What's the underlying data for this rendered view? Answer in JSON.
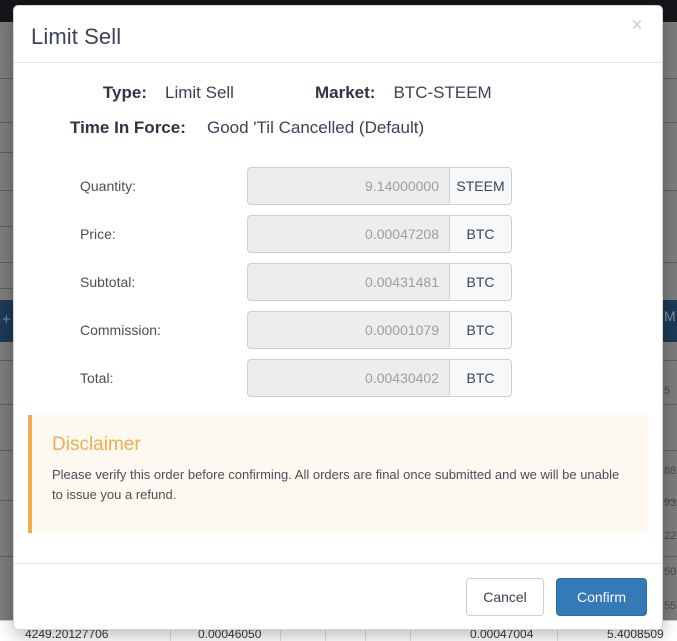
{
  "modal": {
    "title": "Limit Sell",
    "close_label": "×",
    "summary": {
      "type_label": "Type:",
      "type_value": "Limit Sell",
      "market_label": "Market:",
      "market_value": "BTC-STEEM",
      "tif_label": "Time In Force:",
      "tif_value": "Good 'Til Cancelled (Default)"
    },
    "fields": [
      {
        "label": "Quantity:",
        "value": "9.14000000",
        "unit": "STEEM"
      },
      {
        "label": "Price:",
        "value": "0.00047208",
        "unit": "BTC"
      },
      {
        "label": "Subtotal:",
        "value": "0.00431481",
        "unit": "BTC"
      },
      {
        "label": "Commission:",
        "value": "0.00001079",
        "unit": "BTC"
      },
      {
        "label": "Total:",
        "value": "0.00430402",
        "unit": "BTC"
      }
    ],
    "disclaimer": {
      "title": "Disclaimer",
      "text": "Please verify this order before confirming. All orders are final once submitted and we will be unable to issue you a refund.",
      "accent_color": "#f0ad4e",
      "background_color": "#fdf9f1"
    },
    "footer": {
      "cancel_label": "Cancel",
      "confirm_label": "Confirm",
      "confirm_color": "#337ab7"
    }
  },
  "background": {
    "topbar_color": "#14161c",
    "accent_block_color": "#1c3a57",
    "plus_icon": "+",
    "m_glyph": "M",
    "edge_digits": [
      "5",
      "88",
      "93",
      "22",
      "50",
      "55"
    ],
    "table_row": {
      "cells": [
        "4249.20127706",
        "0.00046050",
        "0.00047004",
        "5.4008509"
      ]
    }
  }
}
